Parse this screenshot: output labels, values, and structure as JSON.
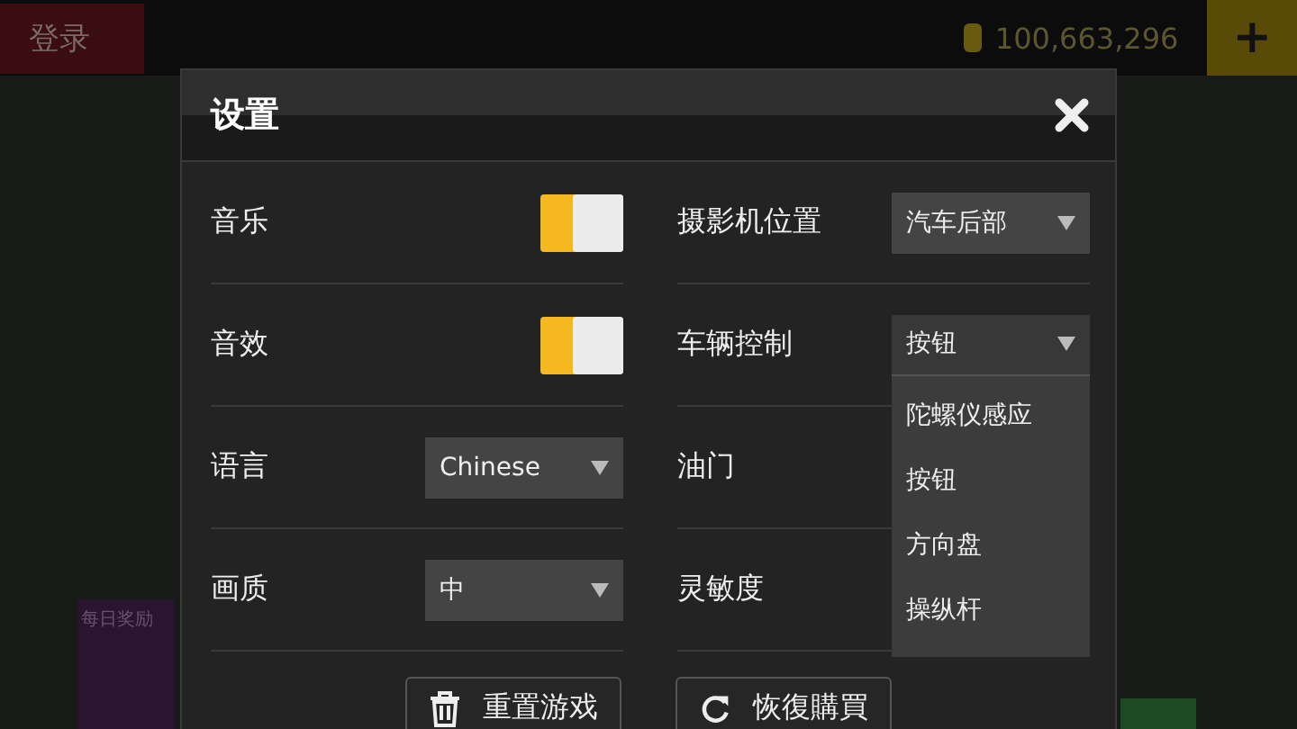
{
  "background": {
    "login_label": "登录",
    "coin_balance": "100,663,296",
    "add_button": "+",
    "daily_reward": "每日奖励"
  },
  "dialog": {
    "title": "设置",
    "left_settings": [
      {
        "label": "音乐",
        "kind": "toggle",
        "on": true
      },
      {
        "label": "音效",
        "kind": "toggle",
        "on": true
      },
      {
        "label": "语言",
        "kind": "select",
        "value": "Chinese"
      },
      {
        "label": "画质",
        "kind": "select",
        "value": "中"
      }
    ],
    "right_settings": [
      {
        "label": "摄影机位置",
        "kind": "select",
        "value": "汽车后部"
      },
      {
        "label": "车辆控制",
        "kind": "select",
        "value": "按钮",
        "expanded": true,
        "options": [
          "陀螺仪感应",
          "按钮",
          "方向盘",
          "操纵杆"
        ]
      },
      {
        "label": "油门",
        "kind": "hidden"
      },
      {
        "label": "灵敏度",
        "kind": "hidden"
      }
    ],
    "buttons": [
      {
        "label": "重置游戏"
      },
      {
        "label": "恢復購買"
      }
    ]
  }
}
